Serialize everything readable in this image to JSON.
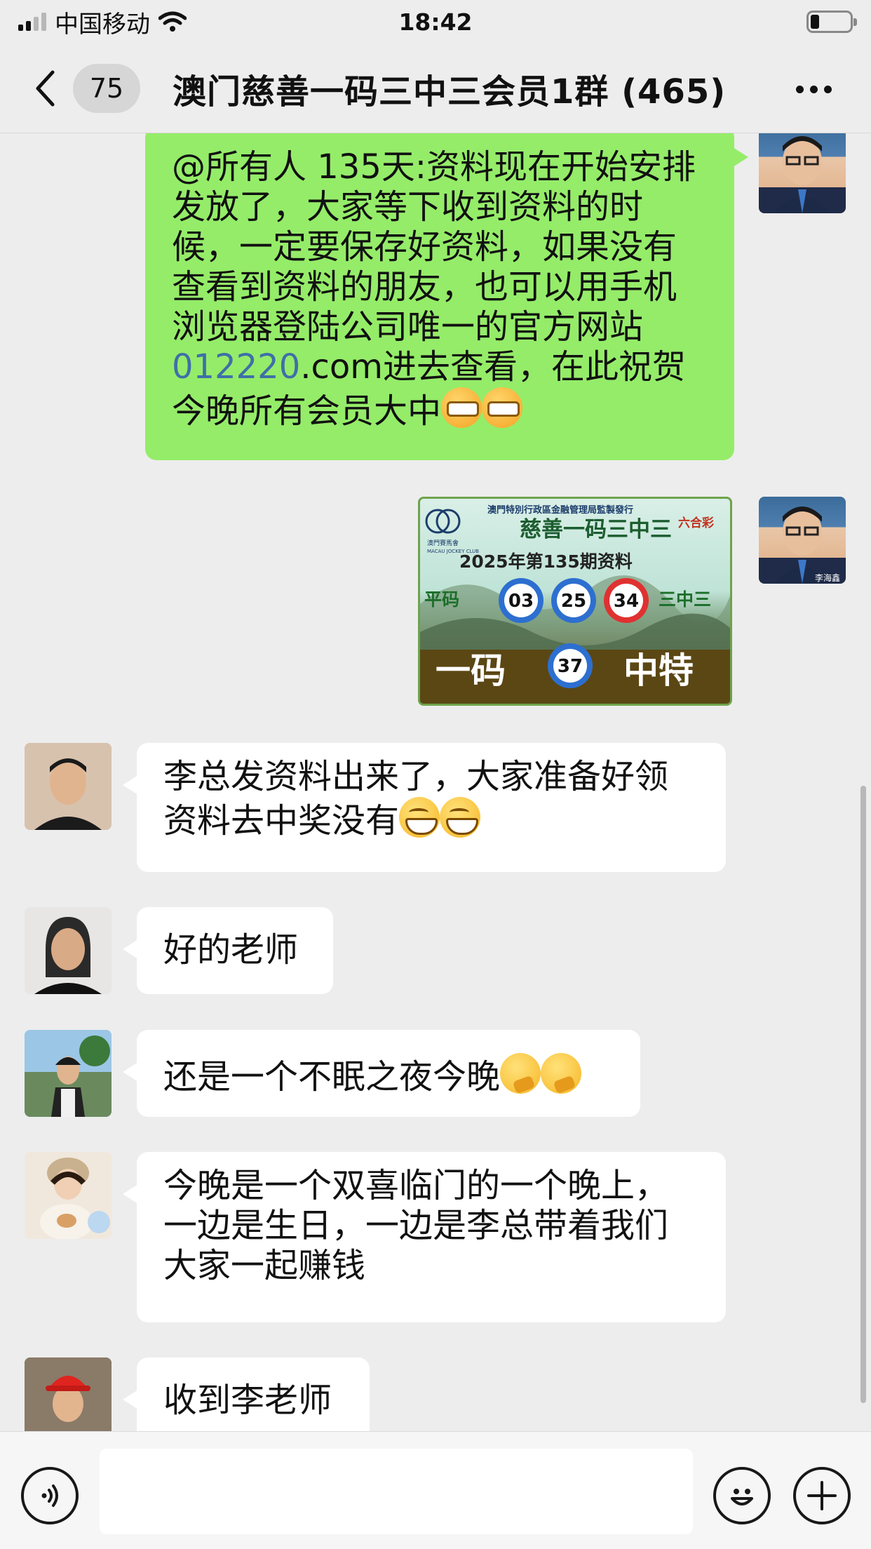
{
  "status_bar": {
    "carrier": "中国移动",
    "time": "18:42"
  },
  "header": {
    "unread_count": "75",
    "title": "澳门慈善一码三中三会员1群 (465)"
  },
  "messages": [
    {
      "sender": "me",
      "text_before_link": "@所有人 135天:资料现在开始安排发放了，大家等下收到资料的时候，一定要保存好资料，如果没有查看到资料的朋友，也可以用手机浏览器登陆公司唯一的官方网站",
      "link": "012220",
      "text_after_link": ".com进去查看，在此祝贺今晚所有会员大中"
    },
    {
      "sender": "me",
      "type": "image",
      "avatar_label": "李海鑫",
      "card": {
        "org_top": "澳門特別行政區金融管理局監製發行",
        "club": "澳門賽馬會",
        "club_en": "MACAU JOCKEY CLUB",
        "brand": "六合彩",
        "title": "慈善一码三中三",
        "issue": "2025年第135期资料",
        "left_label": "平码",
        "right_label": "三中三",
        "balls": [
          "03",
          "25",
          "34"
        ],
        "bottom_left": "一码",
        "special_ball": "37",
        "bottom_right": "中特"
      }
    },
    {
      "sender": "other",
      "text": "李总发资料出来了，大家准备好领资料去中奖没有"
    },
    {
      "sender": "other",
      "text": "好的老师"
    },
    {
      "sender": "other",
      "text": "还是一个不眠之夜今晚"
    },
    {
      "sender": "other",
      "text": "今晚是一个双喜临门的一个晚上，一边是生日，一边是李总带着我们大家一起赚钱"
    },
    {
      "sender": "other",
      "text": "收到李老师"
    }
  ],
  "colors": {
    "my_bubble": "#95ec69",
    "other_bubble": "#ffffff",
    "background": "#ededed",
    "link": "#3f6fa8"
  },
  "icons": [
    "back-icon",
    "more-icon",
    "voice-icon",
    "emoji-icon",
    "plus-icon"
  ]
}
